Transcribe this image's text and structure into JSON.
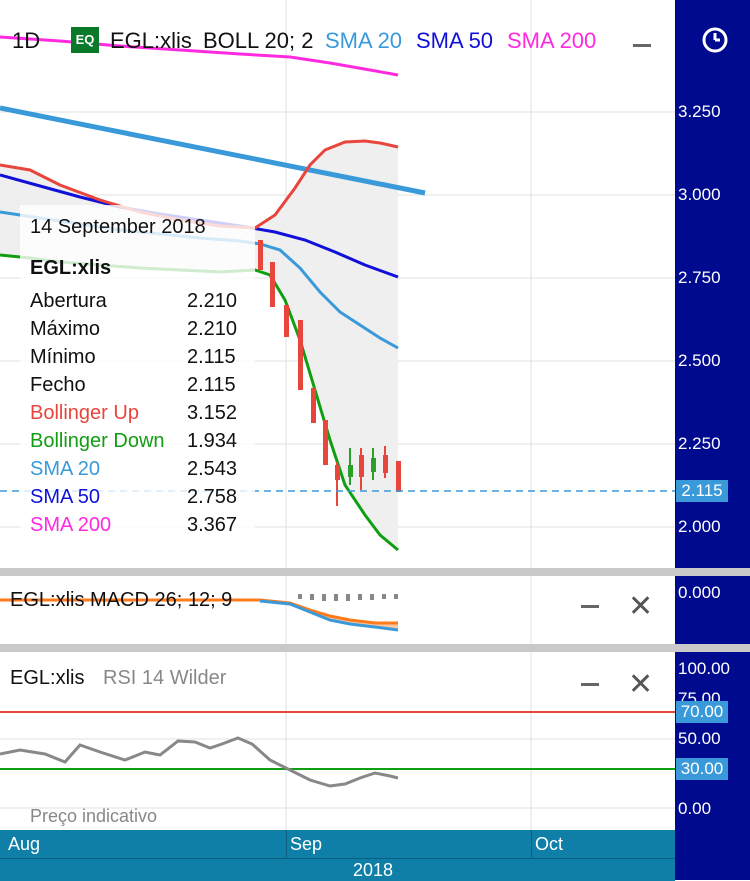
{
  "header": {
    "timeframe": "1D",
    "badge": "EQ",
    "symbol": "EGL:xlis",
    "boll": "BOLL 20; 2",
    "sma20": "SMA 20",
    "sma50": "SMA 50",
    "sma200": "SMA 200"
  },
  "colors": {
    "axis_bg": "#000a8f",
    "xaxis_bg": "#0f7fa8",
    "boll_up": "#e8453c",
    "boll_down": "#119e11",
    "sma20": "#3a9ad9",
    "sma50": "#1010d8",
    "sma200": "#ff2ae0",
    "candle_down": "#e8453c",
    "candle_up": "#2aa02a"
  },
  "tooltip": {
    "date": "14 September 2018",
    "symbol": "EGL:xlis",
    "rows": [
      {
        "label": "Abertura",
        "value": "2.210"
      },
      {
        "label": "Máximo",
        "value": "2.210"
      },
      {
        "label": "Mínimo",
        "value": "2.115"
      },
      {
        "label": "Fecho",
        "value": "2.115"
      },
      {
        "label": "Bollinger Up",
        "value": "3.152"
      },
      {
        "label": "Bollinger Down",
        "value": "1.934"
      },
      {
        "label": "SMA 20",
        "value": "2.543"
      },
      {
        "label": "SMA 50",
        "value": "2.758"
      },
      {
        "label": "SMA 200",
        "value": "3.367"
      }
    ]
  },
  "price_axis": {
    "ticks": [
      "3.250",
      "3.000",
      "2.750",
      "2.500",
      "2.250",
      "2.000"
    ],
    "current": "2.115"
  },
  "macd": {
    "title": "EGL:xlis  MACD 26; 12; 9",
    "axis_label": "0.000"
  },
  "rsi": {
    "symbol": "EGL:xlis",
    "title": "RSI 14 Wilder",
    "axis_ticks": [
      "100.00",
      "75.00",
      "50.00",
      "0.00"
    ],
    "upper": "70.00",
    "lower": "30.00",
    "note": "Preço indicativo"
  },
  "x_axis": {
    "months": [
      "Aug",
      "Sep",
      "Oct"
    ],
    "year": "2018"
  },
  "chart_data": {
    "type": "line",
    "title": "EGL:xlis",
    "ylim": [
      1.85,
      3.42
    ],
    "grid": true,
    "x": [
      "Aug",
      "Sep",
      "Oct"
    ],
    "series": [
      {
        "name": "SMA 200",
        "values": [
          3.41,
          3.39,
          3.367
        ]
      },
      {
        "name": "SMA 50",
        "values": [
          3.0,
          2.93,
          2.758
        ]
      },
      {
        "name": "SMA 20",
        "values": [
          2.85,
          2.86,
          2.543
        ]
      },
      {
        "name": "Bollinger Up",
        "values": [
          3.1,
          2.98,
          3.152
        ]
      },
      {
        "name": "Bollinger Down",
        "values": [
          2.78,
          2.74,
          1.934
        ]
      }
    ],
    "last_close": 2.115
  }
}
